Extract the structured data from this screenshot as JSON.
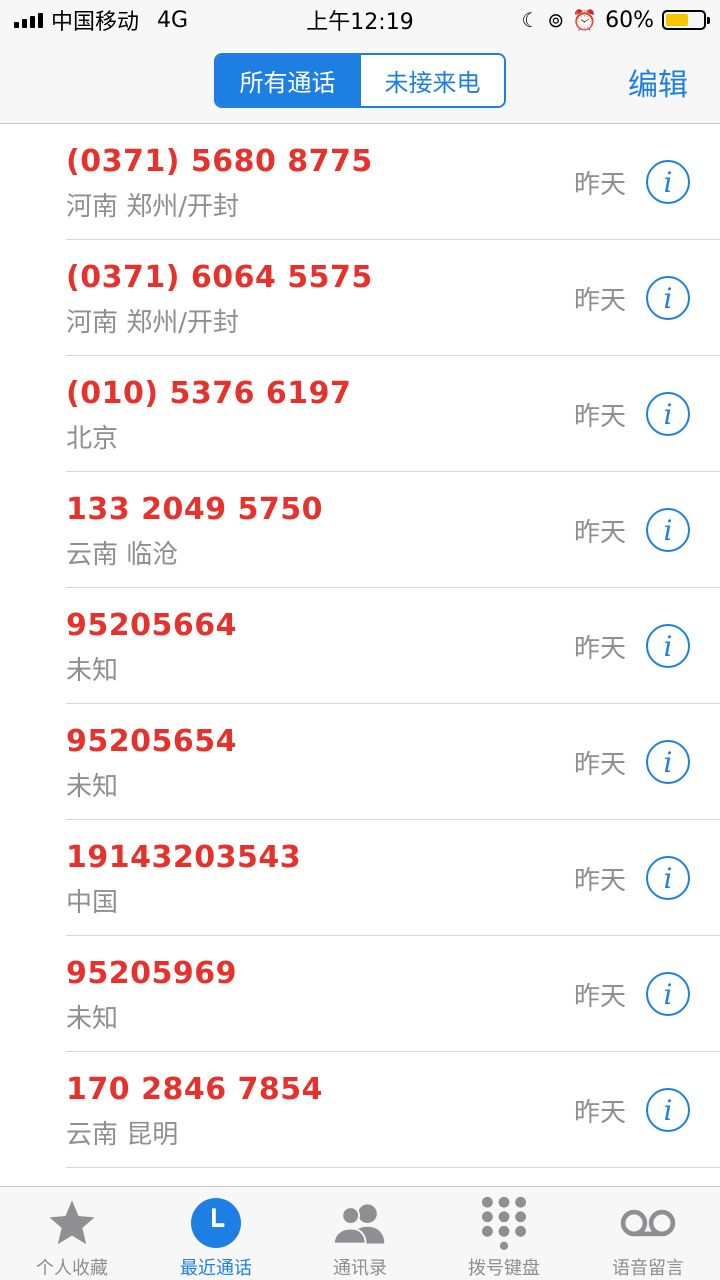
{
  "status_bar": {
    "carrier": "中国移动",
    "network": "4G",
    "time": "上午12:19",
    "battery": "60%",
    "battery_level": 0.6
  },
  "nav": {
    "segments": [
      "所有通话",
      "未接来电"
    ],
    "selected_segment": "所有通话",
    "edit_label": "编辑"
  },
  "calls": [
    {
      "number": "(0371) 5680 8775",
      "location": "河南 郑州/开封",
      "when": "昨天"
    },
    {
      "number": "(0371) 6064 5575",
      "location": "河南 郑州/开封",
      "when": "昨天"
    },
    {
      "number": "(010) 5376 6197",
      "location": "北京",
      "when": "昨天"
    },
    {
      "number": "133 2049 5750",
      "location": "云南 临沧",
      "when": "昨天"
    },
    {
      "number": "95205664",
      "location": "未知",
      "when": "昨天"
    },
    {
      "number": "95205654",
      "location": "未知",
      "when": "昨天"
    },
    {
      "number": "19143203543",
      "location": "中国",
      "when": "昨天"
    },
    {
      "number": "95205969",
      "location": "未知",
      "when": "昨天"
    },
    {
      "number": "170 2846 7854",
      "location": "云南 昆明",
      "when": "昨天"
    }
  ],
  "tabs": [
    {
      "label": "个人收藏",
      "icon": "star-icon"
    },
    {
      "label": "最近通话",
      "icon": "clock-icon"
    },
    {
      "label": "通讯录",
      "icon": "contacts-icon"
    },
    {
      "label": "拨号键盘",
      "icon": "keypad-icon"
    },
    {
      "label": "语音留言",
      "icon": "voicemail-icon"
    }
  ],
  "active_tab": "最近通话",
  "colors": {
    "accent": "#1e7fe3",
    "missed": "#e5322d",
    "secondary_text": "#8e8e93",
    "battery": "#f6c500"
  }
}
